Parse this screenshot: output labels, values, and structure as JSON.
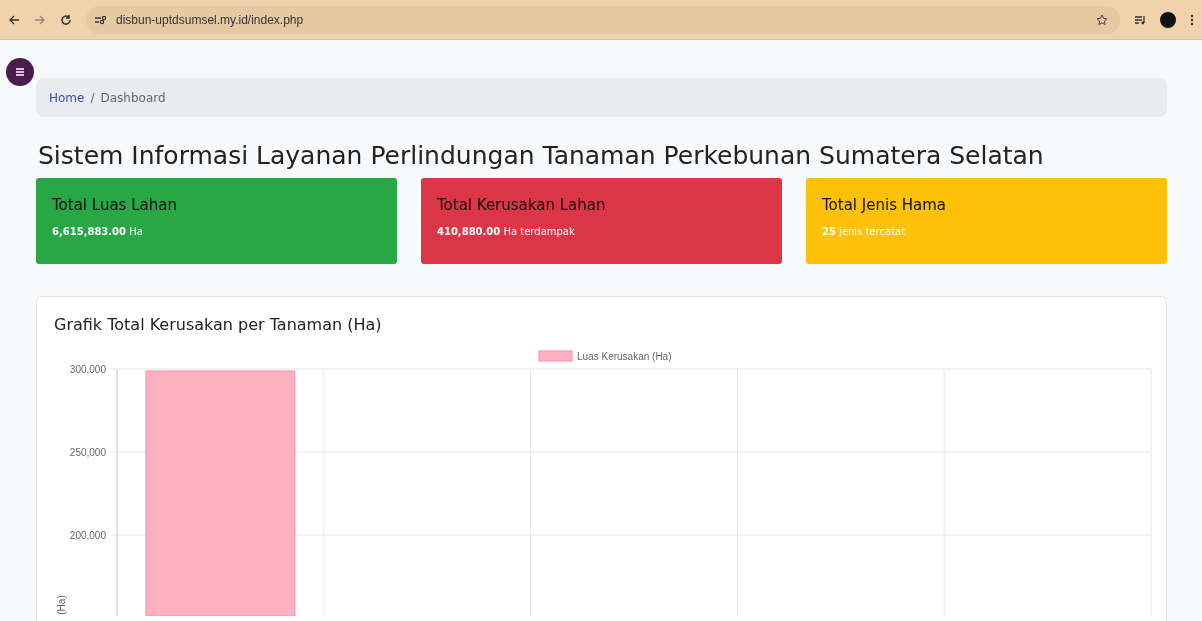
{
  "browser": {
    "url": "disbun-uptdsumsel.my.id/index.php"
  },
  "breadcrumb": [
    {
      "label": "Home",
      "kind": "link"
    },
    {
      "label": "Dashboard",
      "kind": "current"
    }
  ],
  "separator": "/",
  "title": "Sistem Informasi Layanan Perlindungan Tanaman Perkebunan Sumatera Selatan",
  "cards": [
    {
      "title": "Total Luas Lahan",
      "value": "6,615,883.00",
      "unit": "Ha",
      "color": "#28a745"
    },
    {
      "title": "Total Kerusakan Lahan",
      "value": "410,880.00",
      "unit": "Ha terdampak",
      "color": "#dc3545"
    },
    {
      "title": "Total Jenis Hama",
      "value": "25",
      "unit": "jenis tercatat",
      "color": "#ffc107"
    }
  ],
  "chart_panel": {
    "title": "Grafik Total Kerusakan per Tanaman (Ha)",
    "chart_data": {
      "type": "bar",
      "ylabel": "(Ha)",
      "ylim": [
        150000,
        300000
      ],
      "series": [
        {
          "name": "Luas Kerusakan (Ha)",
          "color": "#ffb1c1",
          "values": [
            298800,
            null,
            null,
            null,
            null
          ]
        }
      ],
      "yticks": [
        {
          "value": 300000,
          "label": "300,000"
        },
        {
          "value": 250000,
          "label": "250,000"
        },
        {
          "value": 200000,
          "label": "200,000"
        }
      ]
    }
  }
}
